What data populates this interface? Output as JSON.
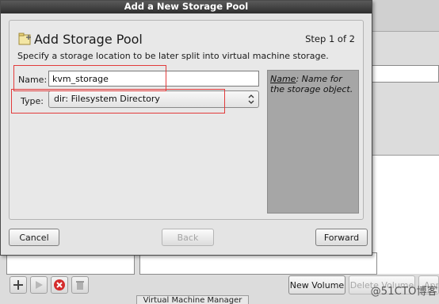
{
  "dialog": {
    "window_title": "Add a New Storage Pool",
    "header_title": "Add Storage Pool",
    "step_label": "Step 1 of 2",
    "subtitle": "Specify a storage location to be later split into virtual machine storage.",
    "name_label": "Name:",
    "name_value": "kvm_storage",
    "type_label": "Type:",
    "type_value": "dir: Filesystem Directory",
    "help_term": "Name",
    "help_desc": ": Name for the storage object.",
    "buttons": {
      "cancel": "Cancel",
      "back": "Back",
      "forward": "Forward"
    }
  },
  "background": {
    "new_volume_label": "New Volume",
    "delete_volume_label": "Delete Volume",
    "partial_right_label": "App",
    "status_title": "Virtual Machine Manager",
    "toolbar_icons": [
      "add-icon",
      "play-icon",
      "stop-icon",
      "trash-icon"
    ]
  },
  "watermark": "@51CTO博客",
  "colors": {
    "highlight": "#e23b3b",
    "titlebar": "#3a3a3a",
    "help_panel": "#a6a6a6"
  }
}
